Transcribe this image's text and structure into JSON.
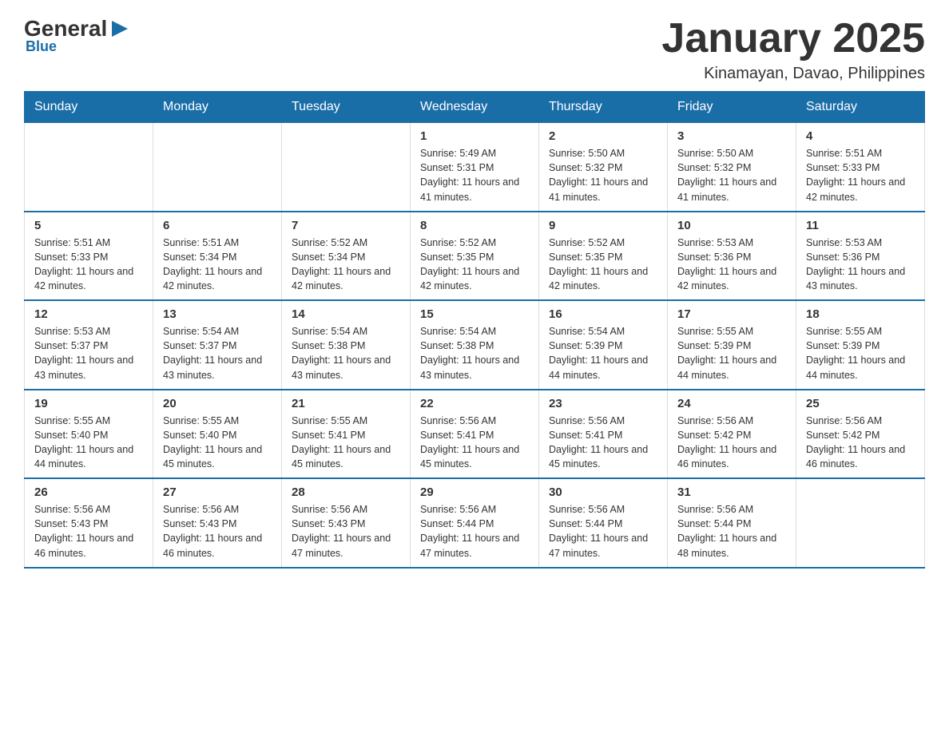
{
  "logo": {
    "general": "General",
    "blue": "Blue",
    "arrow": "▶"
  },
  "header": {
    "month_title": "January 2025",
    "location": "Kinamayan, Davao, Philippines"
  },
  "days_of_week": [
    "Sunday",
    "Monday",
    "Tuesday",
    "Wednesday",
    "Thursday",
    "Friday",
    "Saturday"
  ],
  "weeks": [
    [
      {
        "day": "",
        "info": ""
      },
      {
        "day": "",
        "info": ""
      },
      {
        "day": "",
        "info": ""
      },
      {
        "day": "1",
        "info": "Sunrise: 5:49 AM\nSunset: 5:31 PM\nDaylight: 11 hours and 41 minutes."
      },
      {
        "day": "2",
        "info": "Sunrise: 5:50 AM\nSunset: 5:32 PM\nDaylight: 11 hours and 41 minutes."
      },
      {
        "day": "3",
        "info": "Sunrise: 5:50 AM\nSunset: 5:32 PM\nDaylight: 11 hours and 41 minutes."
      },
      {
        "day": "4",
        "info": "Sunrise: 5:51 AM\nSunset: 5:33 PM\nDaylight: 11 hours and 42 minutes."
      }
    ],
    [
      {
        "day": "5",
        "info": "Sunrise: 5:51 AM\nSunset: 5:33 PM\nDaylight: 11 hours and 42 minutes."
      },
      {
        "day": "6",
        "info": "Sunrise: 5:51 AM\nSunset: 5:34 PM\nDaylight: 11 hours and 42 minutes."
      },
      {
        "day": "7",
        "info": "Sunrise: 5:52 AM\nSunset: 5:34 PM\nDaylight: 11 hours and 42 minutes."
      },
      {
        "day": "8",
        "info": "Sunrise: 5:52 AM\nSunset: 5:35 PM\nDaylight: 11 hours and 42 minutes."
      },
      {
        "day": "9",
        "info": "Sunrise: 5:52 AM\nSunset: 5:35 PM\nDaylight: 11 hours and 42 minutes."
      },
      {
        "day": "10",
        "info": "Sunrise: 5:53 AM\nSunset: 5:36 PM\nDaylight: 11 hours and 42 minutes."
      },
      {
        "day": "11",
        "info": "Sunrise: 5:53 AM\nSunset: 5:36 PM\nDaylight: 11 hours and 43 minutes."
      }
    ],
    [
      {
        "day": "12",
        "info": "Sunrise: 5:53 AM\nSunset: 5:37 PM\nDaylight: 11 hours and 43 minutes."
      },
      {
        "day": "13",
        "info": "Sunrise: 5:54 AM\nSunset: 5:37 PM\nDaylight: 11 hours and 43 minutes."
      },
      {
        "day": "14",
        "info": "Sunrise: 5:54 AM\nSunset: 5:38 PM\nDaylight: 11 hours and 43 minutes."
      },
      {
        "day": "15",
        "info": "Sunrise: 5:54 AM\nSunset: 5:38 PM\nDaylight: 11 hours and 43 minutes."
      },
      {
        "day": "16",
        "info": "Sunrise: 5:54 AM\nSunset: 5:39 PM\nDaylight: 11 hours and 44 minutes."
      },
      {
        "day": "17",
        "info": "Sunrise: 5:55 AM\nSunset: 5:39 PM\nDaylight: 11 hours and 44 minutes."
      },
      {
        "day": "18",
        "info": "Sunrise: 5:55 AM\nSunset: 5:39 PM\nDaylight: 11 hours and 44 minutes."
      }
    ],
    [
      {
        "day": "19",
        "info": "Sunrise: 5:55 AM\nSunset: 5:40 PM\nDaylight: 11 hours and 44 minutes."
      },
      {
        "day": "20",
        "info": "Sunrise: 5:55 AM\nSunset: 5:40 PM\nDaylight: 11 hours and 45 minutes."
      },
      {
        "day": "21",
        "info": "Sunrise: 5:55 AM\nSunset: 5:41 PM\nDaylight: 11 hours and 45 minutes."
      },
      {
        "day": "22",
        "info": "Sunrise: 5:56 AM\nSunset: 5:41 PM\nDaylight: 11 hours and 45 minutes."
      },
      {
        "day": "23",
        "info": "Sunrise: 5:56 AM\nSunset: 5:41 PM\nDaylight: 11 hours and 45 minutes."
      },
      {
        "day": "24",
        "info": "Sunrise: 5:56 AM\nSunset: 5:42 PM\nDaylight: 11 hours and 46 minutes."
      },
      {
        "day": "25",
        "info": "Sunrise: 5:56 AM\nSunset: 5:42 PM\nDaylight: 11 hours and 46 minutes."
      }
    ],
    [
      {
        "day": "26",
        "info": "Sunrise: 5:56 AM\nSunset: 5:43 PM\nDaylight: 11 hours and 46 minutes."
      },
      {
        "day": "27",
        "info": "Sunrise: 5:56 AM\nSunset: 5:43 PM\nDaylight: 11 hours and 46 minutes."
      },
      {
        "day": "28",
        "info": "Sunrise: 5:56 AM\nSunset: 5:43 PM\nDaylight: 11 hours and 47 minutes."
      },
      {
        "day": "29",
        "info": "Sunrise: 5:56 AM\nSunset: 5:44 PM\nDaylight: 11 hours and 47 minutes."
      },
      {
        "day": "30",
        "info": "Sunrise: 5:56 AM\nSunset: 5:44 PM\nDaylight: 11 hours and 47 minutes."
      },
      {
        "day": "31",
        "info": "Sunrise: 5:56 AM\nSunset: 5:44 PM\nDaylight: 11 hours and 48 minutes."
      },
      {
        "day": "",
        "info": ""
      }
    ]
  ],
  "colors": {
    "header_bg": "#1a6ea8",
    "header_text": "#ffffff",
    "border": "#1a6ea8"
  }
}
